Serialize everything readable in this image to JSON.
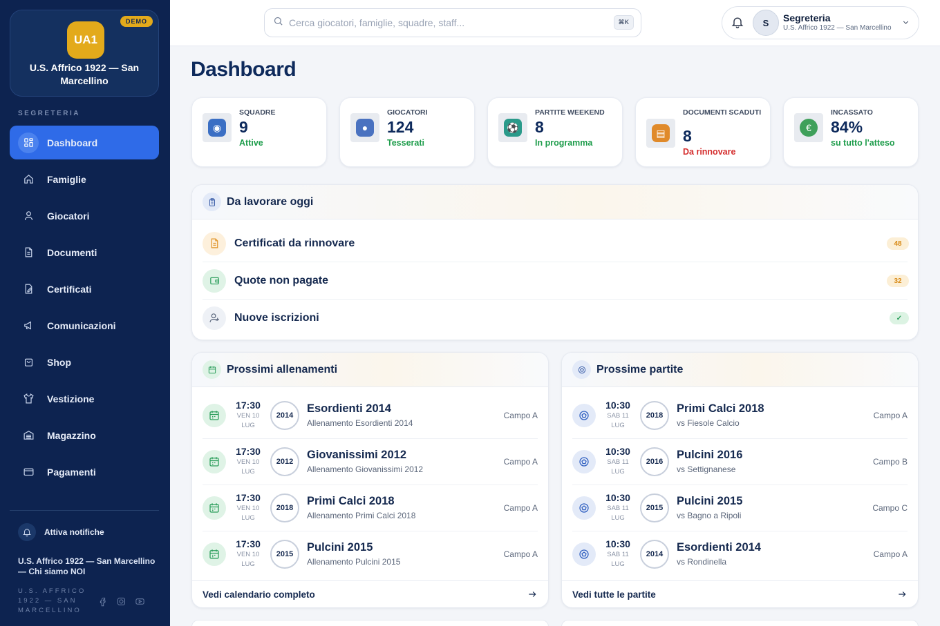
{
  "sidebar": {
    "logo_text": "UA1",
    "demo_badge": "DEMO",
    "club_name": "U.S. Affrico 1922 — San Marcellino",
    "section_label": "SEGRETERIA",
    "items": [
      {
        "label": "Dashboard",
        "icon": "grid-icon"
      },
      {
        "label": "Famiglie",
        "icon": "home-icon"
      },
      {
        "label": "Giocatori",
        "icon": "user-icon"
      },
      {
        "label": "Documenti",
        "icon": "document-icon"
      },
      {
        "label": "Certificati",
        "icon": "certificate-icon"
      },
      {
        "label": "Comunicazioni",
        "icon": "megaphone-icon"
      },
      {
        "label": "Shop",
        "icon": "bag-icon"
      },
      {
        "label": "Vestizione",
        "icon": "shirt-icon"
      },
      {
        "label": "Magazzino",
        "icon": "warehouse-icon"
      },
      {
        "label": "Pagamenti",
        "icon": "card-icon"
      }
    ],
    "notifications_label": "Attiva notifiche",
    "about_link": "U.S. Affrico 1922 — San Marcellino — Chi siamo NOI",
    "club_small": "U.S. AFFRICO 1922 — SAN MARCELLINO"
  },
  "topbar": {
    "search_placeholder": "Cerca giocatori, famiglie, squadre, staff...",
    "shortcut": "⌘K",
    "user_initial": "S",
    "user_name": "Segreteria",
    "user_club": "U.S. Affrico 1922 — San Marcellino"
  },
  "page_title": "Dashboard",
  "stats": [
    {
      "label": "SQUADRE",
      "value": "9",
      "sub": "Attive",
      "sub_color": "#1f9d4c",
      "icon": "shirt-icon",
      "icon_color": "#3b6fc4"
    },
    {
      "label": "GIOCATORI",
      "value": "124",
      "sub": "Tesserati",
      "sub_color": "#1f9d4c",
      "icon": "players-icon",
      "icon_color": "#4a72c0"
    },
    {
      "label": "PARTITE WEEKEND",
      "value": "8",
      "sub": "In programma",
      "sub_color": "#1f9d4c",
      "icon": "soccer-ball-icon",
      "icon_color": "#2a9a8a"
    },
    {
      "label": "DOCUMENTI SCADUTI",
      "value": "8",
      "sub": "Da rinnovare",
      "sub_color": "#d42c2c",
      "icon": "document-icon",
      "icon_color": "#e08a2a"
    },
    {
      "label": "INCASSATO",
      "value": "84%",
      "sub": "su tutto l'atteso",
      "sub_color": "#1f9d4c",
      "icon": "coin-icon",
      "icon_color": "#3fa05a"
    }
  ],
  "tasks": {
    "title": "Da lavorare oggi",
    "items": [
      {
        "label": "Certificati da rinnovare",
        "badge": "48",
        "icon": "document-icon",
        "icon_bg": "#fdf0dc",
        "icon_color": "#e0952a",
        "badge_bg": "#fcefd6",
        "badge_color": "#d88a16"
      },
      {
        "label": "Quote non pagate",
        "badge": "32",
        "icon": "wallet-icon",
        "icon_bg": "#dff3e6",
        "icon_color": "#2a9d5a",
        "badge_bg": "#fcefd6",
        "badge_color": "#d88a16"
      },
      {
        "label": "Nuove iscrizioni",
        "badge": "✓",
        "icon": "user-plus-icon",
        "icon_bg": "#eef1f6",
        "icon_color": "#5a667c",
        "badge_bg": "#dcf3e3",
        "badge_color": "#2a9d5a"
      }
    ]
  },
  "trainings": {
    "title": "Prossimi allenamenti",
    "footer": "Vedi calendario completo",
    "items": [
      {
        "time": "17:30",
        "date": "VEN 10 LUG",
        "year": "2014",
        "name": "Esordienti 2014",
        "sub": "Allenamento Esordienti 2014",
        "field": "Campo A"
      },
      {
        "time": "17:30",
        "date": "VEN 10 LUG",
        "year": "2012",
        "name": "Giovanissimi 2012",
        "sub": "Allenamento Giovanissimi 2012",
        "field": "Campo A"
      },
      {
        "time": "17:30",
        "date": "VEN 10 LUG",
        "year": "2018",
        "name": "Primi Calci 2018",
        "sub": "Allenamento Primi Calci 2018",
        "field": "Campo A"
      },
      {
        "time": "17:30",
        "date": "VEN 10 LUG",
        "year": "2015",
        "name": "Pulcini 2015",
        "sub": "Allenamento Pulcini 2015",
        "field": "Campo A"
      }
    ]
  },
  "matches": {
    "title": "Prossime partite",
    "footer": "Vedi tutte le partite",
    "items": [
      {
        "time": "10:30",
        "date": "SAB 11 LUG",
        "year": "2018",
        "name": "Primi Calci 2018",
        "sub": "vs Fiesole Calcio",
        "field": "Campo A"
      },
      {
        "time": "10:30",
        "date": "SAB 11 LUG",
        "year": "2016",
        "name": "Pulcini 2016",
        "sub": "vs Settignanese",
        "field": "Campo B"
      },
      {
        "time": "10:30",
        "date": "SAB 11 LUG",
        "year": "2015",
        "name": "Pulcini 2015",
        "sub": "vs Bagno a Ripoli",
        "field": "Campo C"
      },
      {
        "time": "10:30",
        "date": "SAB 11 LUG",
        "year": "2014",
        "name": "Esordienti 2014",
        "sub": "vs Rondinella",
        "field": "Campo A"
      }
    ]
  }
}
